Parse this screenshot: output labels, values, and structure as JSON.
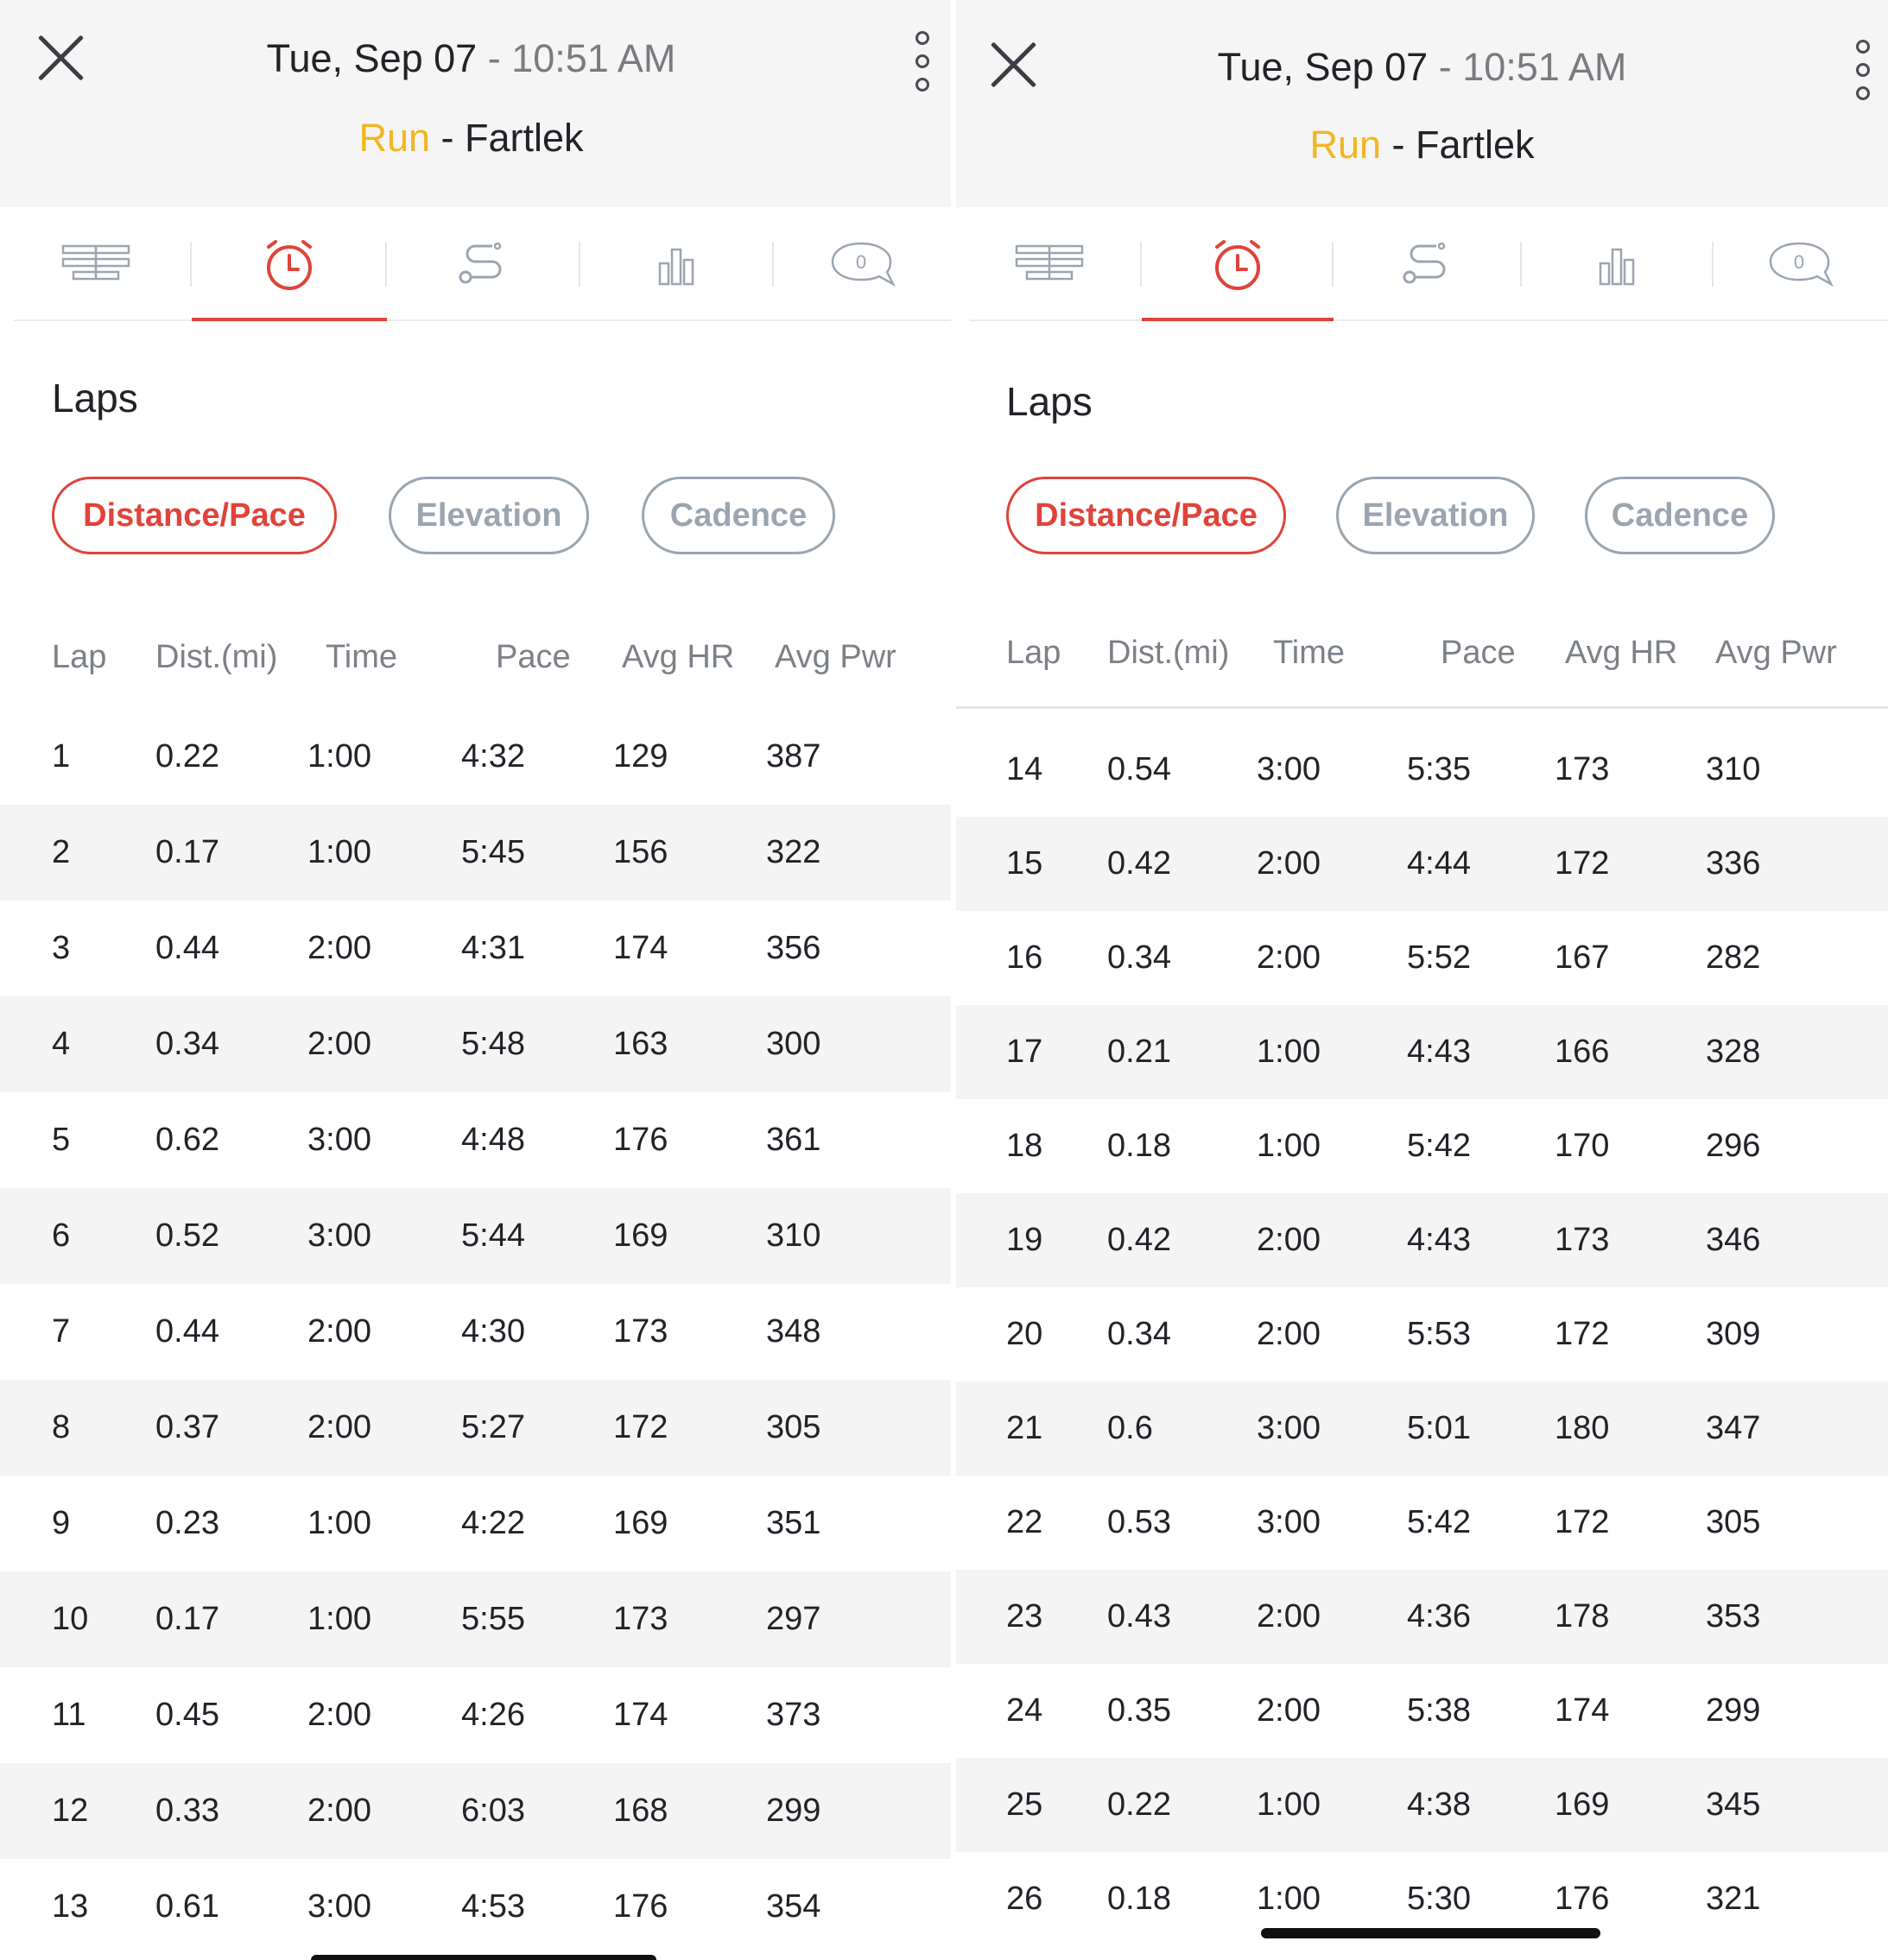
{
  "header": {
    "date": "Tue, Sep 07",
    "date_sep": " - ",
    "time": "10:51 AM",
    "sport": "Run",
    "sport_sep": " - ",
    "workout_name": "Fartlek"
  },
  "tabs": [
    {
      "icon": "summary-icon",
      "active": false
    },
    {
      "icon": "alarm-clock-icon",
      "active": true
    },
    {
      "icon": "route-icon",
      "active": false
    },
    {
      "icon": "bar-chart-icon",
      "active": false
    },
    {
      "icon": "comment-icon",
      "active": false,
      "badge": "0"
    }
  ],
  "section_title": "Laps",
  "filters": [
    "Distance/Pace",
    "Elevation",
    "Cadence"
  ],
  "active_filter": "Distance/Pace",
  "columns": [
    "Lap",
    "Dist.(mi)",
    "Time",
    "Pace",
    "Avg HR",
    "Avg Pwr"
  ],
  "colors": {
    "accent": "#e0433a",
    "sport": "#f2b620",
    "muted": "#9aa5b0"
  },
  "left_panel": {
    "laps": [
      [
        "1",
        "0.22",
        "1:00",
        "4:32",
        "129",
        "387"
      ],
      [
        "2",
        "0.17",
        "1:00",
        "5:45",
        "156",
        "322"
      ],
      [
        "3",
        "0.44",
        "2:00",
        "4:31",
        "174",
        "356"
      ],
      [
        "4",
        "0.34",
        "2:00",
        "5:48",
        "163",
        "300"
      ],
      [
        "5",
        "0.62",
        "3:00",
        "4:48",
        "176",
        "361"
      ],
      [
        "6",
        "0.52",
        "3:00",
        "5:44",
        "169",
        "310"
      ],
      [
        "7",
        "0.44",
        "2:00",
        "4:30",
        "173",
        "348"
      ],
      [
        "8",
        "0.37",
        "2:00",
        "5:27",
        "172",
        "305"
      ],
      [
        "9",
        "0.23",
        "1:00",
        "4:22",
        "169",
        "351"
      ],
      [
        "10",
        "0.17",
        "1:00",
        "5:55",
        "173",
        "297"
      ],
      [
        "11",
        "0.45",
        "2:00",
        "4:26",
        "174",
        "373"
      ],
      [
        "12",
        "0.33",
        "2:00",
        "6:03",
        "168",
        "299"
      ],
      [
        "13",
        "0.61",
        "3:00",
        "4:53",
        "176",
        "354"
      ]
    ]
  },
  "right_panel": {
    "laps": [
      [
        "14",
        "0.54",
        "3:00",
        "5:35",
        "173",
        "310"
      ],
      [
        "15",
        "0.42",
        "2:00",
        "4:44",
        "172",
        "336"
      ],
      [
        "16",
        "0.34",
        "2:00",
        "5:52",
        "167",
        "282"
      ],
      [
        "17",
        "0.21",
        "1:00",
        "4:43",
        "166",
        "328"
      ],
      [
        "18",
        "0.18",
        "1:00",
        "5:42",
        "170",
        "296"
      ],
      [
        "19",
        "0.42",
        "2:00",
        "4:43",
        "173",
        "346"
      ],
      [
        "20",
        "0.34",
        "2:00",
        "5:53",
        "172",
        "309"
      ],
      [
        "21",
        "0.6",
        "3:00",
        "5:01",
        "180",
        "347"
      ],
      [
        "22",
        "0.53",
        "3:00",
        "5:42",
        "172",
        "305"
      ],
      [
        "23",
        "0.43",
        "2:00",
        "4:36",
        "178",
        "353"
      ],
      [
        "24",
        "0.35",
        "2:00",
        "5:38",
        "174",
        "299"
      ],
      [
        "25",
        "0.22",
        "1:00",
        "4:38",
        "169",
        "345"
      ],
      [
        "26",
        "0.18",
        "1:00",
        "5:30",
        "176",
        "321"
      ]
    ]
  }
}
